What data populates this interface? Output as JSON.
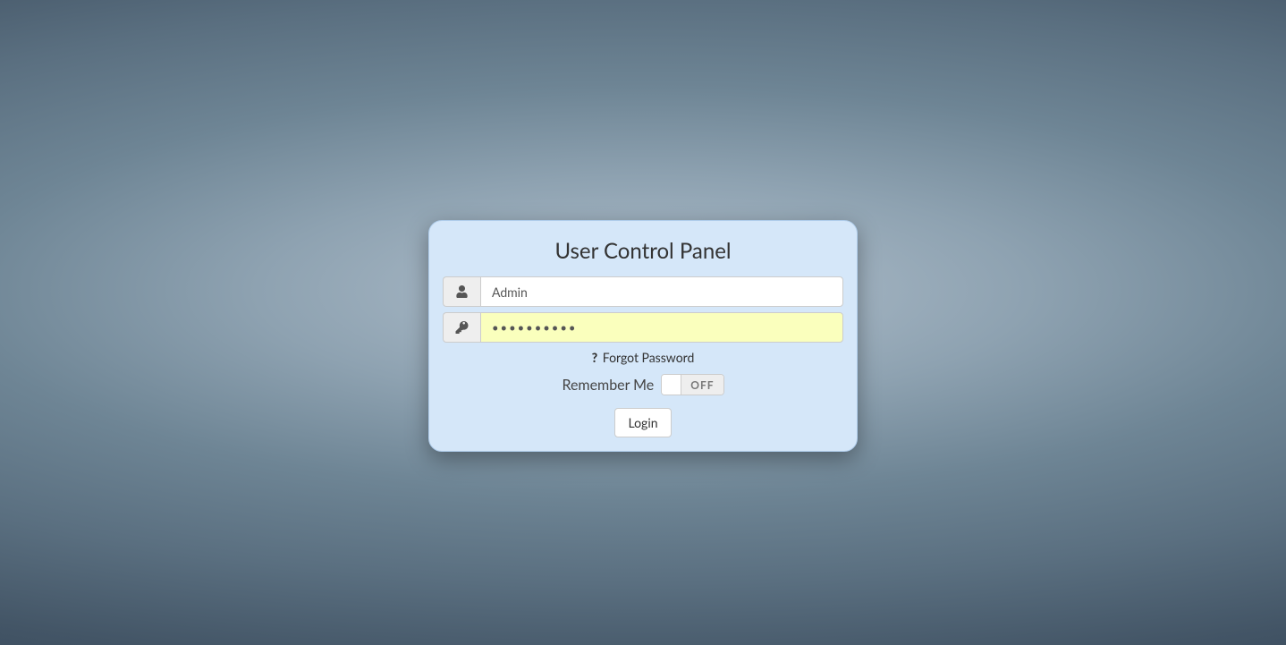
{
  "panel": {
    "title": "User Control Panel",
    "username_value": "Admin",
    "password_value": "••••••••••",
    "forgot_label": "Forgot Password",
    "remember_label": "Remember Me",
    "toggle_state_label": "OFF",
    "login_label": "Login"
  }
}
